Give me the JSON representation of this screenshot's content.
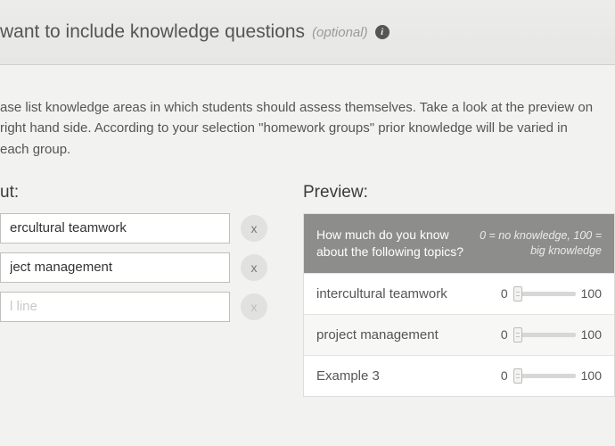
{
  "header": {
    "title_prefix": "want to include knowledge questions",
    "optional_label": "(optional)"
  },
  "description": "ase list knowledge areas in which students should assess themselves. Take a look at the preview on right hand side. According to your selection \"homework groups\" prior knowledge will be varied in each group.",
  "input": {
    "heading": "ut:",
    "rows": [
      {
        "value": "ercultural teamwork",
        "placeholder": "",
        "removable": true
      },
      {
        "value": "ject management",
        "placeholder": "",
        "removable": true
      },
      {
        "value": "",
        "placeholder": "l line",
        "removable": false
      }
    ],
    "remove_glyph": "x"
  },
  "preview": {
    "heading": "Preview:",
    "question": "How much do you know about the following topics?",
    "scale_label": "0 = no knowledge, 100 = big knowledge",
    "min": "0",
    "max": "100",
    "rows": [
      {
        "label": "intercultural teamwork"
      },
      {
        "label": "project management"
      },
      {
        "label": "Example 3"
      }
    ]
  }
}
